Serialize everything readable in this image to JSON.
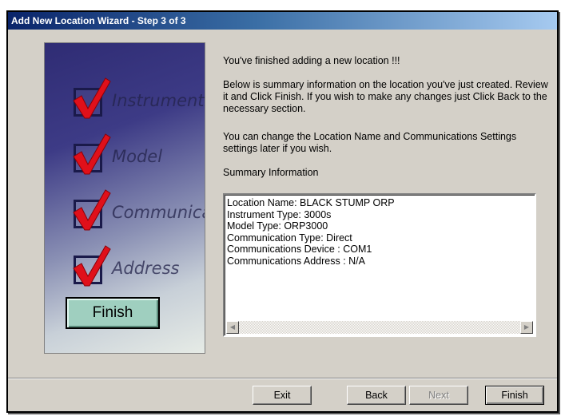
{
  "window": {
    "title": "Add New Location Wizard - Step 3 of 3"
  },
  "sidebar": {
    "steps": [
      {
        "label": "Instruments"
      },
      {
        "label": "Model"
      },
      {
        "label": "Communications"
      },
      {
        "label": "Address"
      }
    ],
    "finish_label": "Finish"
  },
  "content": {
    "heading": "You've finished adding a new location !!!",
    "paragraph1": "Below is summary information on the location you've just created.  Review it and Click Finish.  If you wish to make any changes just Click Back to the necessary section.",
    "paragraph2": "You can change the Location Name and Communications Settings settings later if you wish.",
    "summary_label": "Summary Information",
    "summary_lines": [
      "Location Name: BLACK STUMP ORP",
      "Instrument Type: 3000s",
      "Model Type: ORP3000",
      "Communication Type: Direct",
      "Communications Device : COM1",
      "Communications Address : N/A"
    ]
  },
  "buttons": {
    "exit": "Exit",
    "back": "Back",
    "next": "Next",
    "finish": "Finish"
  },
  "colors": {
    "title_bar_start": "#0a246a",
    "window_face": "#d4d0c8",
    "check_mark": "#e0101a",
    "sidebar_finish": "#9fcfbf"
  }
}
